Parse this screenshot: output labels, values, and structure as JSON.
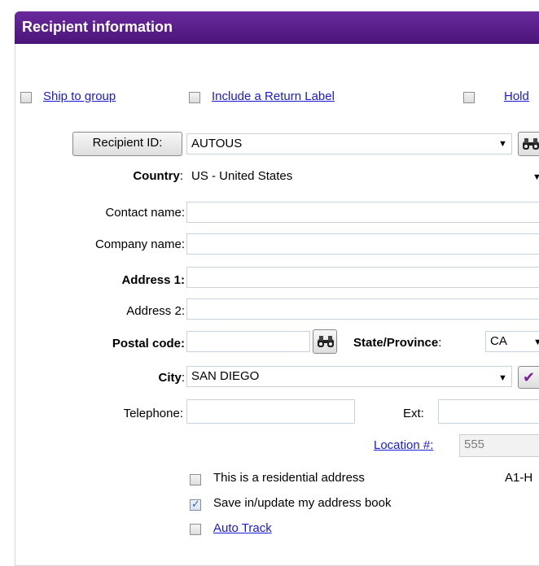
{
  "header": {
    "title": "Recipient information"
  },
  "options": {
    "ship_to_group": "Ship to group",
    "include_return_label": "Include a Return Label",
    "hold": "Hold"
  },
  "form": {
    "recipient_id_button": "Recipient ID:",
    "recipient_id_value": "AUTOUS",
    "country_label": "Country",
    "country_colon": ":",
    "country_value": "US - United States",
    "contact_name_label": "Contact name:",
    "contact_name_value": "",
    "company_name_label": "Company name:",
    "company_name_value": "",
    "address1_label": "Address 1:",
    "address1_value": "",
    "address2_label": "Address 2:",
    "address2_value": "",
    "postal_code_label": "Postal code:",
    "postal_code_value": "",
    "state_label": "State/Province",
    "state_colon": ":",
    "state_value": "CA",
    "city_label": "City",
    "city_colon": ":",
    "city_value": "SAN DIEGO",
    "telephone_label": "Telephone:",
    "telephone_value": "",
    "ext_label": "Ext:",
    "ext_value": "",
    "location_label": "Location #:",
    "location_value": "555",
    "side_code": "A1-H"
  },
  "checkboxes": {
    "residential": {
      "label": "This is a residential address",
      "checked": false
    },
    "save_address_book": {
      "label": "Save in/update my address book",
      "checked": true
    },
    "auto_track": {
      "label": "Auto Track",
      "checked": false
    }
  },
  "colors": {
    "header_bg": "#4f1a80",
    "link": "#1a1ad6",
    "checkmark_purple": "#7a1f9e"
  },
  "icons": {
    "binoculars": "binoculars-icon",
    "dropdown": "chevron-down-icon",
    "check": "checkmark-icon"
  }
}
